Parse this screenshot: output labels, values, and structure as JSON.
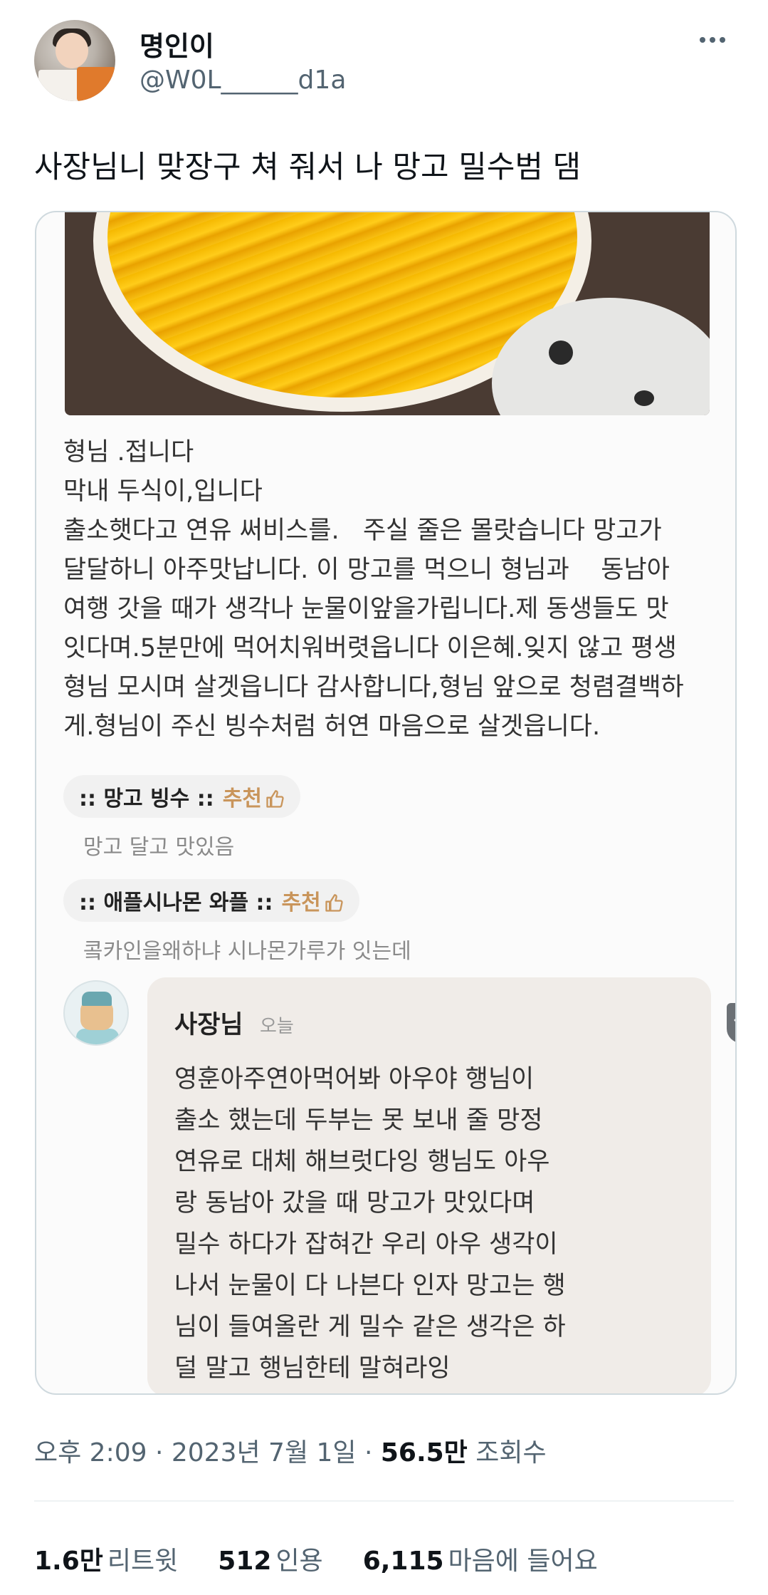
{
  "author": {
    "display_name": "명인이",
    "handle": "@W0L______d1a"
  },
  "tweet": {
    "text": "사장님니 맞장구 쳐 줘서 나 망고 밀수범 댐"
  },
  "screenshot": {
    "review_lines": [
      "형님 .접니다",
      "막내 두식이,입니다",
      "출소햇다고 연유 써비스를.   주실 줄은 몰랏습니다 망고가",
      "달달하니 아주맛납니다. 이 망고를 먹으니 형님과    동남아",
      "여행 갓을 때가 생각나 눈물이앞을가립니다.제 동생들도 맛",
      "잇다며.5분만에 먹어치워버렷읍니다 이은혜.잊지 않고 평생",
      "형님 모시며 살겟읍니다 감사합니다,형님 앞으로 청렴결백하",
      "게.형님이 주신 빙수처럼 허연 마음으로 살겟읍니다."
    ],
    "menu_items": [
      {
        "name": ":: 망고 빙수 ::",
        "recommend": "추천",
        "comment": "망고 달고 맛있음"
      },
      {
        "name": ":: 애플시나몬 와플 ::",
        "recommend": "추천",
        "comment": "콬카인을왜하냐 시나몬가루가 잇는데"
      }
    ],
    "owner_reply": {
      "name": "사장님",
      "date": "오늘",
      "lines": [
        "영훈아주연아먹어봐 아우야 행님이",
        "출소 했는데 두부는 못 보내 줄 망정",
        "연유로 대체 해브럿다잉 행님도 아우",
        "랑 동남아 갔을 때 망고가 맛있다며",
        "밀수 하다가 잡혀간 우리 아우 생각이",
        "나서 눈물이 다 나븐다 인자 망고는 행",
        "님이 들여올란 게 밀수 같은 생각은 하",
        "덜 말고 행님한테 말혀라잉"
      ]
    }
  },
  "meta": {
    "time_date": "오후 2:09 · 2023년 7월 1일 · ",
    "views_count": "56.5만",
    "views_label": " 조회수"
  },
  "stats": {
    "retweets_count": "1.6만",
    "retweets_label": "리트윗",
    "quotes_count": "512",
    "quotes_label": "인용",
    "likes_count": "6,115",
    "likes_label": "마음에 들어요"
  },
  "colors": {
    "text_primary": "#0f1419",
    "text_secondary": "#536471",
    "recommend_accent": "#c9955b",
    "reply_bubble": "#f0ece8"
  },
  "icons": [
    "more-icon",
    "thumbs-up-icon",
    "chevron-down-icon"
  ]
}
